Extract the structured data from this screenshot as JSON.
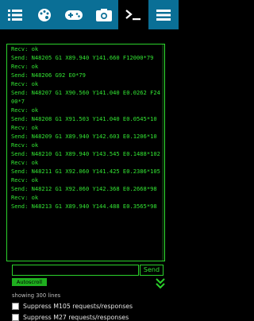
{
  "toolbar": {
    "items": [
      {
        "name": "menu-lines",
        "icon": "list-icon"
      },
      {
        "name": "dashboard",
        "icon": "palette-icon"
      },
      {
        "name": "gamepad",
        "icon": "gamepad-icon"
      },
      {
        "name": "camera",
        "icon": "camera-icon"
      },
      {
        "name": "terminal",
        "icon": "terminal-icon",
        "active": true
      },
      {
        "name": "hamburger",
        "icon": "hamburger-icon"
      }
    ]
  },
  "terminal": {
    "lines": [
      "Recv: ok",
      "Send: N48205 G1 X89.940 Y141.660 F12000*79",
      "Recv: ok",
      "Send: N48206 G92 E0*79",
      "Recv: ok",
      "Send: N48207 G1 X90.560 Y141.040 E0.0262 F2400*7",
      "Recv: ok",
      "Send: N48208 G1 X91.503 Y141.040 E0.0545*10",
      "Recv: ok",
      "Send: N48209 G1 X89.940 Y142.603 E0.1206*10",
      "Recv: ok",
      "Send: N48210 G1 X89.940 Y143.545 E0.1488*102",
      "Recv: ok",
      "Send: N48211 G1 X92.060 Y141.425 E0.2386*105",
      "Recv: ok",
      "Send: N48212 G1 X92.060 Y142.368 E0.2668*98",
      "Recv: ok",
      "Send: N48213 G1 X89.940 Y144.488 E0.3565*98"
    ],
    "command_value": "",
    "send_label": "Send",
    "autoscroll_label": "Autoscroll",
    "line_count": "showing 300 lines"
  },
  "options": [
    "Suppress M105 requests/responses",
    "Suppress M27 requests/responses"
  ],
  "colors": {
    "toolbar": "#0a6f96",
    "terminal_text": "#33e633",
    "background": "#000000"
  }
}
